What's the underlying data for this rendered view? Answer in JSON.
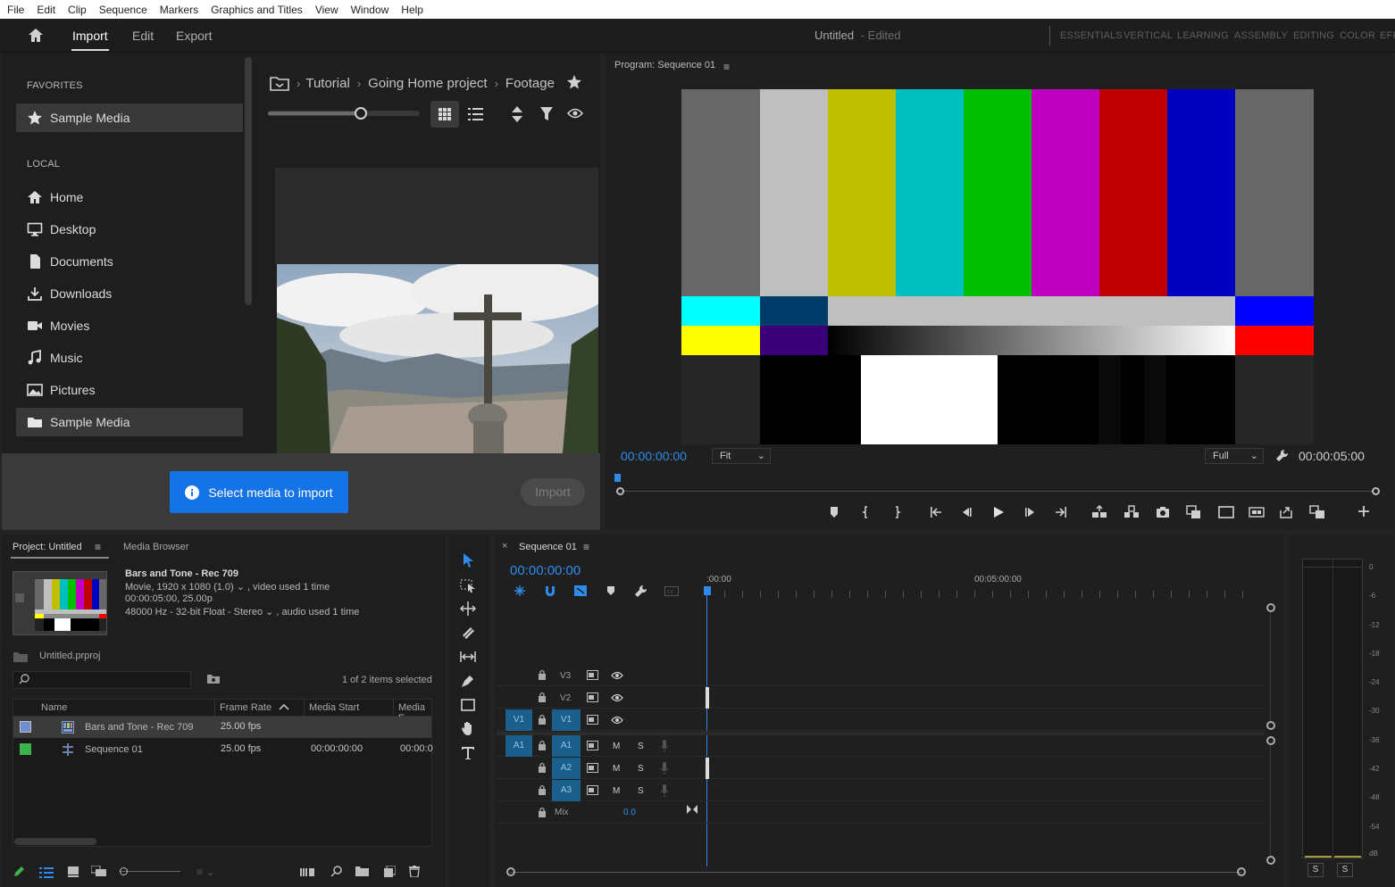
{
  "menu": [
    "File",
    "Edit",
    "Clip",
    "Sequence",
    "Markers",
    "Graphics and Titles",
    "View",
    "Window",
    "Help"
  ],
  "header": {
    "tabs": [
      "Import",
      "Edit",
      "Export"
    ],
    "active_tab": "Import",
    "doc_title": "Untitled",
    "doc_status": "- Edited",
    "workspaces": [
      "ESSENTIALS",
      "VERTICAL",
      "LEARNING",
      "ASSEMBLY",
      "EDITING",
      "COLOR",
      "EFF"
    ]
  },
  "import_sidebar": {
    "favorites_heading": "FAVORITES",
    "favorites": [
      "Sample Media"
    ],
    "local_heading": "LOCAL",
    "local": [
      "Home",
      "Desktop",
      "Documents",
      "Downloads",
      "Movies",
      "Music",
      "Pictures",
      "Sample Media"
    ]
  },
  "breadcrumb": [
    "Tutorial",
    "Going Home project",
    "Footage"
  ],
  "import_footer": {
    "select_button": "Select media to import",
    "import_button": "Import"
  },
  "program_monitor": {
    "title": "Program: Sequence 01",
    "timecode_current": "00:00:00:00",
    "timecode_duration": "00:00:05:00",
    "fit_select": "Fit",
    "quality_select": "Full"
  },
  "project": {
    "tab_project": "Project: Untitled",
    "tab_media_browser": "Media Browser",
    "clip_name": "Bars and Tone - Rec 709",
    "clip_line1": "Movie, 1920 x 1080 (1.0)",
    "clip_line1_suffix": ", video used 1 time",
    "clip_line2": "00:00:05:00, 25.00p",
    "clip_line3": "48000 Hz - 32-bit Float - Stereo",
    "clip_line3_suffix": ", audio used 1 time",
    "project_file": "Untitled.prproj",
    "selection_status": "1 of 2 items selected",
    "columns": [
      "Name",
      "Frame Rate",
      "Media Start",
      "Media E"
    ],
    "rows": [
      {
        "name": "Bars and Tone - Rec 709",
        "frame_rate": "25.00 fps",
        "media_start": "",
        "media_end": "",
        "color": "#6f8fd0"
      },
      {
        "name": "Sequence 01",
        "frame_rate": "25.00 fps",
        "media_start": "00:00:00:00",
        "media_end": "00:00:0",
        "color": "#3bb54a"
      }
    ]
  },
  "timeline": {
    "tab": "Sequence 01",
    "timecode": "00:00:00:00",
    "ruler_labels": [
      ":00:00",
      "00:05:00:00"
    ],
    "video_tracks": [
      "V3",
      "V2",
      "V1"
    ],
    "audio_tracks": [
      "A1",
      "A2",
      "A3"
    ],
    "source_video": "V1",
    "source_audio": "A1",
    "mix_label": "Mix",
    "mix_value": "0.0",
    "mute_label": "M",
    "solo_label": "S"
  },
  "audio_meter": {
    "ticks": [
      "0",
      "-6",
      "-12",
      "-18",
      "-24",
      "-30",
      "-36",
      "-42",
      "-48",
      "-54",
      "dB"
    ],
    "solo_labels": [
      "S",
      "S"
    ]
  },
  "colors": {
    "accent_blue": "#2d8ceb",
    "button_blue": "#1473e6",
    "bg": "#232323"
  }
}
